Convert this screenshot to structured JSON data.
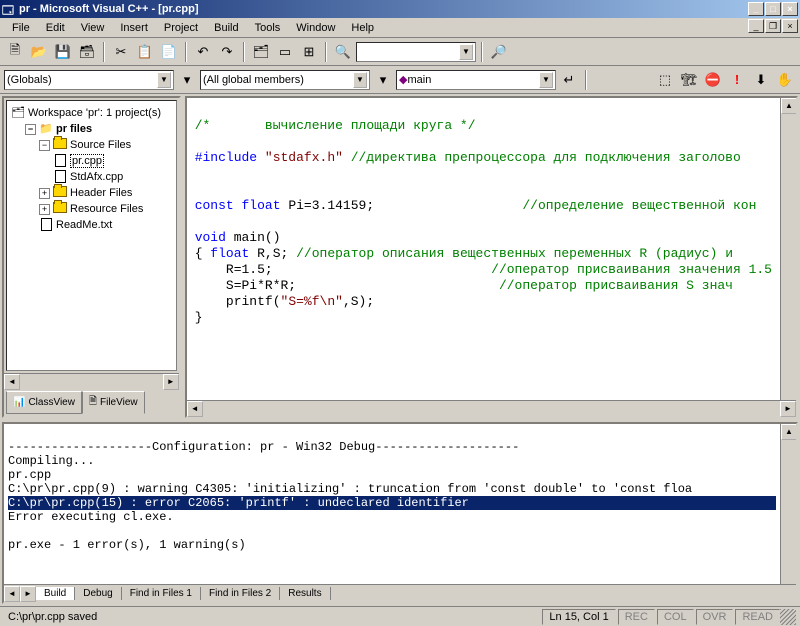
{
  "title": "pr - Microsoft Visual C++ - [pr.cpp]",
  "menu": [
    "File",
    "Edit",
    "View",
    "Insert",
    "Project",
    "Build",
    "Tools",
    "Window",
    "Help"
  ],
  "combos": {
    "scope": "(Globals)",
    "members": "(All global members)",
    "func": "main"
  },
  "workspace": {
    "root": "Workspace 'pr': 1 project(s)",
    "project": "pr files",
    "folders": {
      "source": "Source Files",
      "header": "Header Files",
      "resource": "Resource Files"
    },
    "files": {
      "prcpp": "pr.cpp",
      "stdafx": "StdAfx.cpp",
      "readme": "ReadMe.txt"
    },
    "tabs": {
      "class": "ClassView",
      "file": "FileView"
    }
  },
  "code": {
    "l1": "/*       вычисление площади круга */",
    "l2a": "#include ",
    "l2b": "\"stdafx.h\"",
    "l2c": " //директива препроцессора для подключения заголово",
    "l3": "const float Pi=3.14159;                   //определение вещественной кон",
    "l3kw": "const float",
    "l3rest": " Pi=3.14159;                   ",
    "l3com": "//определение вещественной кон",
    "l4kw": "void",
    "l4rest": " main()",
    "l5a": "{ ",
    "l5kw": "float",
    "l5rest": " R,S; ",
    "l5com": "//оператор описания вещественных переменных R (радиус) и",
    "l6": "    R=1.5;                            ",
    "l6com": "//оператор присваивания значения 1.5",
    "l7": "    S=Pi*R*R;                          ",
    "l7com": "//оператор присваивания S знач",
    "l8a": "    printf(",
    "l8str": "\"S=%f\\n\"",
    "l8b": ",S);",
    "l9": "}"
  },
  "output": {
    "l1": "--------------------Configuration: pr - Win32 Debug--------------------",
    "l2": "Compiling...",
    "l3": "pr.cpp",
    "l4": "C:\\pr\\pr.cpp(9) : warning C4305: 'initializing' : truncation from 'const double' to 'const floa",
    "l5": "C:\\pr\\pr.cpp(15) : error C2065: 'printf' : undeclared identifier",
    "l6": "Error executing cl.exe.",
    "l7": "",
    "l8": "pr.exe - 1 error(s), 1 warning(s)",
    "tabs": [
      "Build",
      "Debug",
      "Find in Files 1",
      "Find in Files 2",
      "Results"
    ]
  },
  "status": {
    "msg": "C:\\pr\\pr.cpp saved",
    "pos": "Ln 15, Col 1",
    "ind": [
      "REC",
      "COL",
      "OVR",
      "READ"
    ]
  }
}
